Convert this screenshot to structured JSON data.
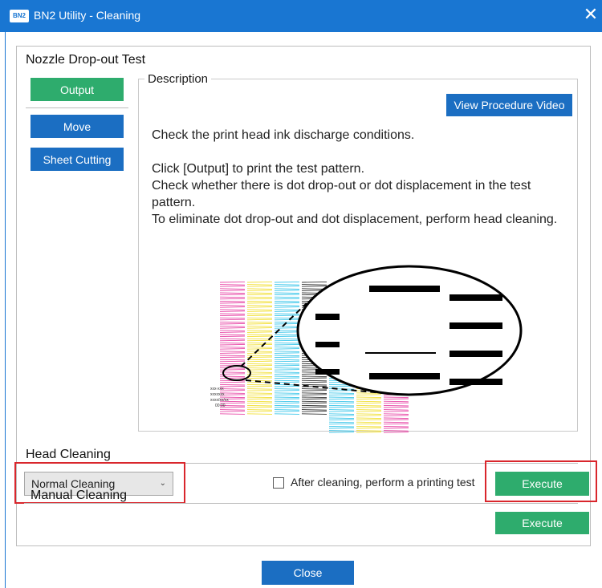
{
  "window": {
    "app_icon": "BN2",
    "title": "BN2 Utility - Cleaning",
    "close_glyph": "✕"
  },
  "nozzle_test": {
    "title": "Nozzle Drop-out Test",
    "buttons": {
      "output": "Output",
      "move": "Move",
      "sheet_cutting": "Sheet Cutting"
    },
    "description": {
      "legend": "Description",
      "video_button": "View Procedure Video",
      "paragraphs": [
        "Check the print head ink discharge conditions.",
        "Click [Output] to print the test pattern.\nCheck whether there is dot drop-out or dot displacement in the test pattern.\nTo eliminate dot drop-out and dot displacement, perform head cleaning."
      ]
    },
    "pattern_colors": [
      "#e84aa8",
      "#f2e038",
      "#3ec7ea",
      "#333333",
      "#3ec7ea",
      "#f2e038",
      "#e84aa8"
    ],
    "pattern_caption": [
      "xxx-xxx",
      "xxxxxxx",
      "xxxx/xx/xx",
      "00:00"
    ]
  },
  "head_cleaning": {
    "title": "Head Cleaning",
    "selected_mode": "Normal Cleaning",
    "dropdown_glyph": "⌄",
    "after_cleaning_label": "After cleaning, perform a printing test",
    "after_cleaning_checked": false,
    "execute_label": "Execute"
  },
  "manual_cleaning": {
    "title": "Manual Cleaning",
    "execute_label": "Execute"
  },
  "footer": {
    "close_label": "Close"
  },
  "colors": {
    "accent_blue": "#1b6ec2",
    "action_green": "#2eac6d",
    "highlight_red": "#d9262c",
    "titlebar_blue": "#1976d2"
  }
}
